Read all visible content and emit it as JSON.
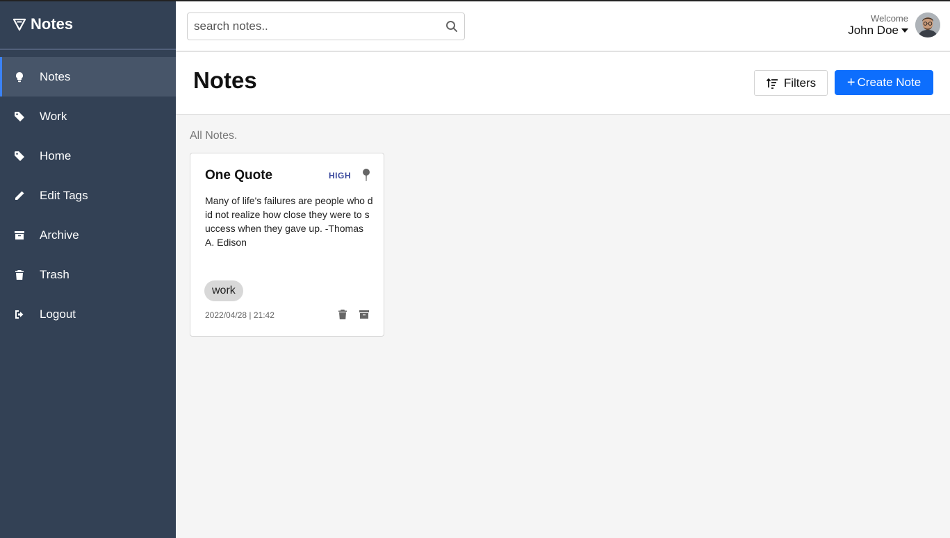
{
  "app": {
    "brand": "Notes"
  },
  "sidebar": {
    "items": [
      {
        "label": "Notes",
        "icon": "lightbulb-icon",
        "active": true
      },
      {
        "label": "Work",
        "icon": "tag-icon"
      },
      {
        "label": "Home",
        "icon": "tag-icon"
      },
      {
        "label": "Edit Tags",
        "icon": "pencil-icon"
      },
      {
        "label": "Archive",
        "icon": "archive-icon"
      },
      {
        "label": "Trash",
        "icon": "trash-icon"
      },
      {
        "label": "Logout",
        "icon": "logout-icon"
      }
    ]
  },
  "header": {
    "search_placeholder": "search notes..",
    "search_value": "",
    "welcome": "Welcome",
    "user_name": "John Doe"
  },
  "main": {
    "title": "Notes",
    "filters_label": "Filters",
    "create_label": "Create Note",
    "section_label": "All Notes."
  },
  "notes": [
    {
      "title": "One Quote",
      "priority": "HIGH",
      "body": "Many of life's failures are people who did not realize how close they were to success when they gave up. -Thomas A. Edison",
      "tag": "work",
      "date": "2022/04/28 | 21:42"
    }
  ],
  "colors": {
    "sidebar_bg": "#334155",
    "sidebar_active": "#475569",
    "accent": "#0d6efd",
    "priority": "#3b4a9e"
  }
}
